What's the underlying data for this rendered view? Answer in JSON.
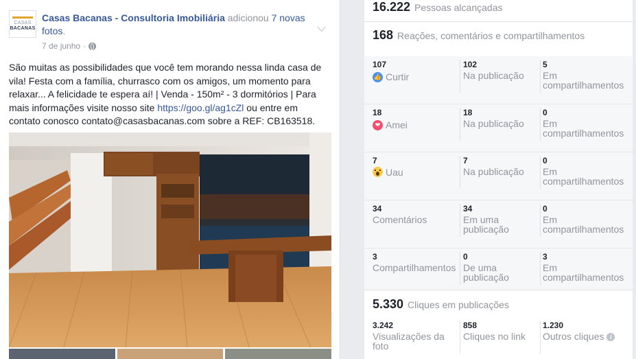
{
  "post": {
    "page_name": "Casas Bacanas - Consultoria Imobiliária",
    "action_text": " adicionou ",
    "photos_link": "7 novas fotos",
    "action_end": ".",
    "date": "7 de junho",
    "separator": "·",
    "logo_line1": "CASAS",
    "logo_line2": "BACANAS",
    "text_before_link": "São muitas as possibilidades que você tem morando nessa linda casa de vila! Festa com a família, churrasco com os amigos, um momento para relaxar... A felicidade te espera aí! | Venda - 150m² - 3 dormitórios | Para mais informações visite nosso site ",
    "text_link": "https://goo.gl/ag1cZl",
    "text_after_link": " ou entre em contato conosco contato@casasbacanas.com sobre a REF: CB163518."
  },
  "insights": {
    "reach": {
      "value": "16.222",
      "label": "Pessoas alcançadas"
    },
    "engagement": {
      "value": "168",
      "label": "Reações, comentários e compartilhamentos"
    },
    "rows": [
      {
        "icon": "like-icon",
        "total": "107",
        "label": "Curtir",
        "post_value": "102",
        "post_label": "Na publicação",
        "share_value": "5",
        "share_label": "Em compartilhamentos"
      },
      {
        "icon": "love-icon",
        "total": "18",
        "label": "Amei",
        "post_value": "18",
        "post_label": "Na publicação",
        "share_value": "0",
        "share_label": "Em compartilhamentos"
      },
      {
        "icon": "wow-icon",
        "total": "7",
        "label": "Uau",
        "post_value": "7",
        "post_label": "Na publicação",
        "share_value": "0",
        "share_label": "Em compartilhamentos"
      },
      {
        "icon": "",
        "total": "34",
        "label": "Comentários",
        "post_value": "34",
        "post_label": "Em uma publicação",
        "share_value": "0",
        "share_label": "Em compartilhamentos"
      },
      {
        "icon": "",
        "total": "3",
        "label": "Compartilhamentos",
        "post_value": "0",
        "post_label": "De uma publicação",
        "share_value": "3",
        "share_label": "Em compartilhamentos"
      }
    ],
    "clicks": {
      "value": "5.330",
      "label": "Cliques em publicações",
      "photo_views": {
        "value": "3.242",
        "label": "Visualizações da foto"
      },
      "link_clicks": {
        "value": "858",
        "label": "Cliques no link"
      },
      "other_clicks": {
        "value": "1.230",
        "label": "Outros cliques"
      }
    }
  },
  "colors": {
    "link": "#365899",
    "muted": "#90949c",
    "like": "#4e8ff2",
    "love": "#f0506e",
    "wow": "#f7c948"
  }
}
